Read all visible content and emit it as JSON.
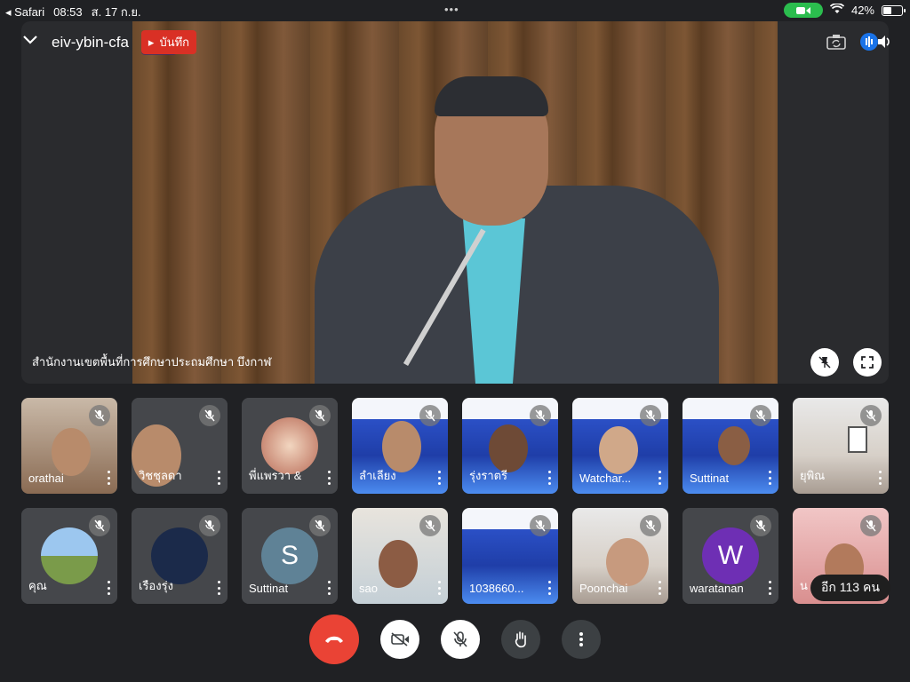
{
  "status_bar": {
    "back_app": "Safari",
    "time": "08:53",
    "date": "ส. 17 ก.ย.",
    "battery": "42%"
  },
  "meeting": {
    "title": "eiv-ybin-cfa",
    "recording_label": "บันทึก",
    "speaker_name": "สำนักงานเขตพื้นที่การศึกษาประถมศึกษา บึงกาฬ"
  },
  "participants": [
    {
      "name": "orathai",
      "bg": "room"
    },
    {
      "name": "วิชชุลดา",
      "bg": "dark"
    },
    {
      "name": "พี่แพรวา &",
      "bg": "dark",
      "avatar": "photo"
    },
    {
      "name": "ลำเลียง",
      "bg": "slide"
    },
    {
      "name": "รุ่งราตรี",
      "bg": "slide"
    },
    {
      "name": "Watchar...",
      "bg": "slide"
    },
    {
      "name": "Suttinat",
      "bg": "slide"
    },
    {
      "name": "ยุพิณ",
      "bg": "office"
    },
    {
      "name": "คุณ",
      "bg": "dark",
      "avatar": "photo"
    },
    {
      "name": "เรืองรุ่ง",
      "bg": "dark",
      "avatar": "navy"
    },
    {
      "name": "Suttinat",
      "bg": "dark",
      "avatar_letter": "S",
      "avatar_color": "#5f8296"
    },
    {
      "name": "sao",
      "bg": "teal"
    },
    {
      "name": "1038660...",
      "bg": "slide"
    },
    {
      "name": "Poonchai",
      "bg": "office"
    },
    {
      "name": "waratanan",
      "bg": "dark",
      "avatar_letter": "W",
      "avatar_color": "#6e2fb4"
    },
    {
      "name": "น",
      "bg": "pink"
    }
  ],
  "more_participants": "อีก 113 คน",
  "colors": {
    "end_call": "#ea4335",
    "record": "#d93025",
    "background": "#202124"
  }
}
